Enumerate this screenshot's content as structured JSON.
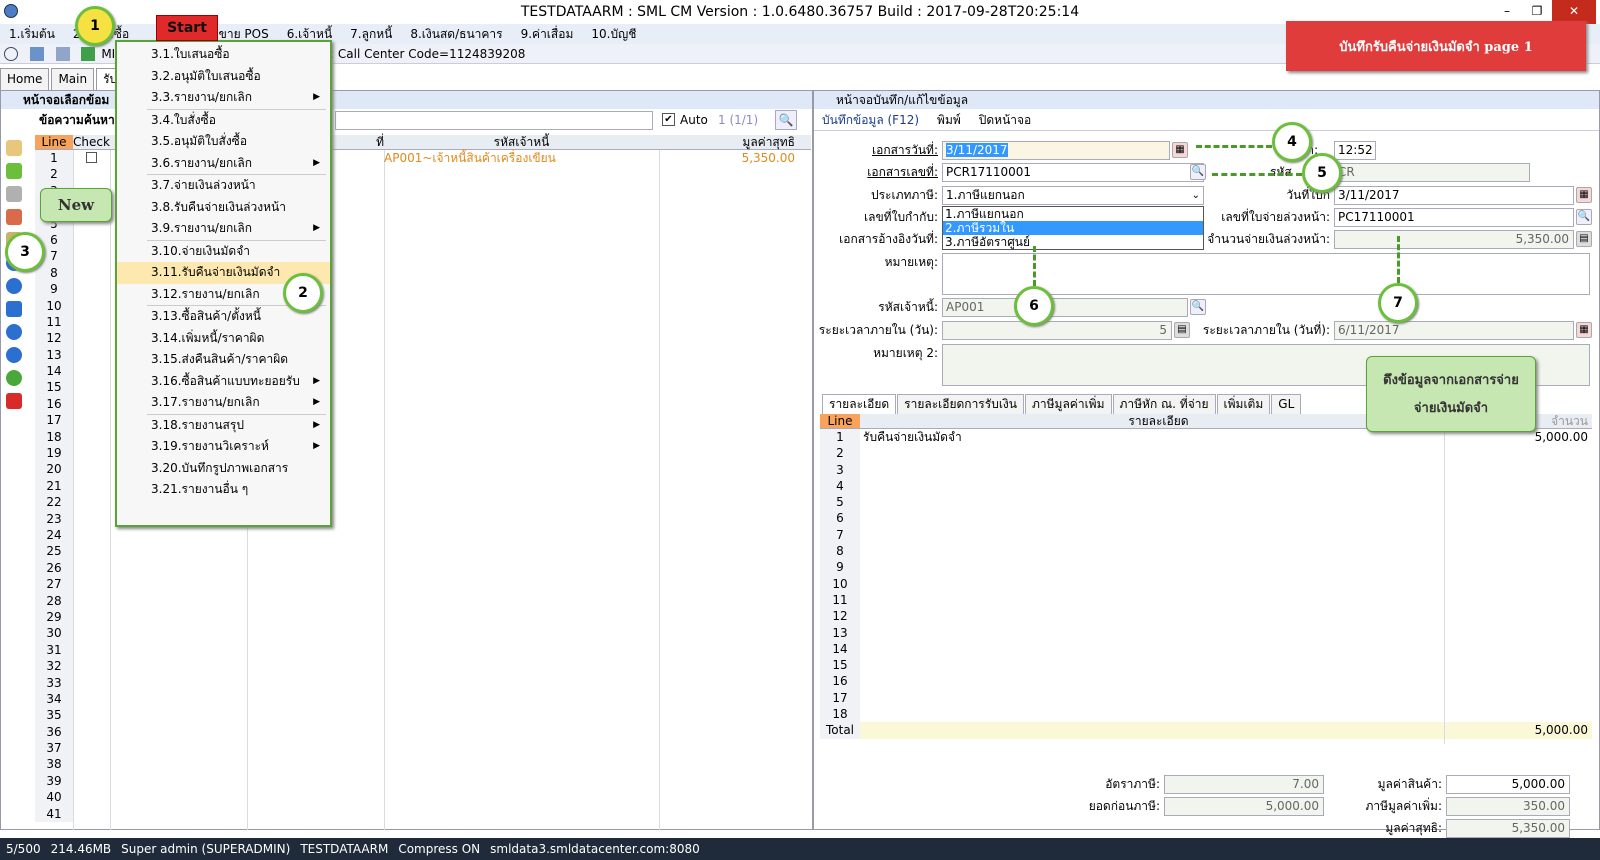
{
  "window": {
    "title": "TESTDATAARM : SML CM Version : 1.0.6480.36757  Build : 2017-09-28T20:25:14",
    "min": "–",
    "restore": "❐",
    "close": "✕"
  },
  "menubar": [
    "1.เริ่มต้น",
    "2.",
    "3.ซื้อ",
    "",
    "5.ขาย POS",
    "6.เจ้าหนี้",
    "7.ลูกหนี้",
    "8.เงินสด/ธนาคาร",
    "9.ค่าเสื่อม",
    "10.บัญชี"
  ],
  "banner": "บันทึกรับคืนจ่ายเงินมัดจำ page 1",
  "toolbar2": {
    "mis": "MIS",
    "info": "A : Call Center Code=1124839208"
  },
  "tabs": [
    "Home",
    "Main",
    "รับคื"
  ],
  "left_pane": {
    "header": "หน้าจอเลือกข้อม",
    "search_label": "ข้อความค้นหา",
    "auto_label": "Auto",
    "paging": "1 (1/1)",
    "columns": [
      "Line",
      "Check",
      "",
      "ที่",
      "รหัสเจ้าหนี้",
      "มูลค่าสุทธิ"
    ],
    "row1": {
      "line": "1",
      "creditor": "AP001~เจ้าหนี้สินค้าเครื่องเขียน",
      "net": "5,350.00"
    },
    "lines": [
      "1",
      "2",
      "3",
      "4",
      "5",
      "6",
      "7",
      "8",
      "9",
      "10",
      "11",
      "12",
      "13",
      "14",
      "15",
      "16",
      "17",
      "18",
      "19",
      "20",
      "21",
      "22",
      "23",
      "24",
      "25",
      "26",
      "27",
      "28",
      "29",
      "30",
      "31",
      "32",
      "33",
      "34",
      "35",
      "36",
      "37",
      "38",
      "39",
      "40",
      "41"
    ]
  },
  "dropdown_menu": {
    "start_button": "Start",
    "groups": [
      [
        {
          "label": "3.1.ใบเสนอซื้อ"
        },
        {
          "label": "3.2.อนุมัติใบเสนอซื้อ"
        },
        {
          "label": "3.3.รายงาน/ยกเลิก",
          "sub": true
        }
      ],
      [
        {
          "label": "3.4.ใบสั่งซื้อ"
        },
        {
          "label": "3.5.อนุมัติใบสั่งซื้อ"
        },
        {
          "label": "3.6.รายงาน/ยกเลิก",
          "sub": true
        }
      ],
      [
        {
          "label": "3.7.จ่ายเงินล่วงหน้า"
        },
        {
          "label": "3.8.รับคืนจ่ายเงินล่วงหน้า"
        },
        {
          "label": "3.9.รายงาน/ยกเลิก",
          "sub": true
        }
      ],
      [
        {
          "label": "3.10.จ่ายเงินมัดจำ"
        },
        {
          "label": "3.11.รับคืนจ่ายเงินมัดจำ",
          "highlight": true
        },
        {
          "label": "3.12.รายงาน/ยกเลิก",
          "sub": true
        }
      ],
      [
        {
          "label": "3.13.ซื้อสินค้า/ตั้งหนี้"
        },
        {
          "label": "3.14.เพิ่มหนี้/ราคาผิด"
        },
        {
          "label": "3.15.ส่งคืนสินค้า/ราคาผิด"
        },
        {
          "label": "3.16.ซื้อสินค้าแบบทะยอยรับ",
          "sub": true
        },
        {
          "label": "3.17.รายงาน/ยกเลิก",
          "sub": true
        }
      ],
      [
        {
          "label": "3.18.รายงานสรุป",
          "sub": true
        },
        {
          "label": "3.19.รายงานวิเคราะห์",
          "sub": true
        },
        {
          "label": "3.20.บันทึกรูปภาพเอกสาร"
        },
        {
          "label": "3.21.รายงานอื่น ๆ"
        }
      ]
    ]
  },
  "right_pane": {
    "header": "หน้าจอบันทึก/แก้ไขข้อมูล",
    "toolbar": {
      "save": "บันทึกข้อมูล (F12)",
      "print": "พิมพ์",
      "close": "ปิดหน้าจอ"
    },
    "form": {
      "doc_date_label": "เอกสารวันที่:",
      "doc_date": "3/11/2017",
      "time_label": "ลา:",
      "time": "12:52",
      "doc_no_label": "เอกสารเลขที่:",
      "doc_no": "PCR17110001",
      "code_label": "รหัส",
      "code": "CR",
      "tax_type_label": "ประเภทภาษี:",
      "tax_type": "1.ภาษีแยกนอก",
      "tax_options": [
        "1.ภาษีแยกนอก",
        "2.ภาษีรวมใน",
        "3.ภาษีอัตราศูนย์"
      ],
      "tax_date_label": "วันที่ใบก",
      "tax_date": "3/11/2017",
      "invoice_label": "เลขที่ใบกำกับ:",
      "adv_no_label": "เลขที่ใบจ่ายล่วงหน้า:",
      "adv_no": "PC17110001",
      "ref_date_label": "เอกสารอ้างอิงวันที่:",
      "adv_amount_label": "จำนวนจ่ายเงินล่วงหน้า:",
      "adv_amount": "5,350.00",
      "remark_label": "หมายเหตุ:",
      "creditor_label": "รหัสเจ้าหนี้:",
      "creditor": "AP001",
      "term_days_label": "ระยะเวลาภายใน (วัน):",
      "term_days": "5",
      "term_date_label": "ระยะเวลาภายใน (วันที่):",
      "term_date": "6/11/2017",
      "remark2_label": "หมายเหตุ 2:"
    },
    "tabs": [
      "รายละเอียด",
      "รายละเอียดการรับเงิน",
      "ภาษีมูลค่าเพิ่ม",
      "ภาษีหัก ณ. ที่จ่าย",
      "เพิ่มเติม",
      "GL"
    ],
    "grid": {
      "columns": [
        "Line",
        "รายละเอียด",
        "จำนวน"
      ],
      "row1": {
        "desc": "รับคืนจ่ายเงินมัดจำ",
        "amount": "5,000.00"
      },
      "lines": [
        "1",
        "2",
        "3",
        "4",
        "5",
        "6",
        "7",
        "8",
        "9",
        "10",
        "11",
        "12",
        "13",
        "14",
        "15",
        "16",
        "17",
        "18"
      ],
      "total_label": "Total",
      "total": "5,000.00"
    },
    "totals": {
      "tax_rate_label": "อัตราภาษี:",
      "tax_rate": "7.00",
      "before_tax_label": "ยอดก่อนภาษี:",
      "before_tax": "5,000.00",
      "goods_value_label": "มูลค่าสินค้า:",
      "goods_value": "5,000.00",
      "vat_label": "ภาษีมูลค่าเพิ่ม:",
      "vat": "350.00",
      "net_label": "มูลค่าสุทธิ:",
      "net": "5,350.00"
    }
  },
  "annotations": {
    "steps": [
      "1",
      "2",
      "3",
      "4",
      "5",
      "6",
      "7"
    ],
    "new_label": "New",
    "callout": [
      "ดึงข้อมูลจากเอกสารจ่าย",
      "จ่ายเงินมัดจำ"
    ]
  },
  "statusbar": [
    "5/500",
    "214.46MB",
    "Super admin (SUPERADMIN)",
    "TESTDATAARM",
    "Compress ON",
    "smldata3.smldatacenter.com:8080"
  ]
}
